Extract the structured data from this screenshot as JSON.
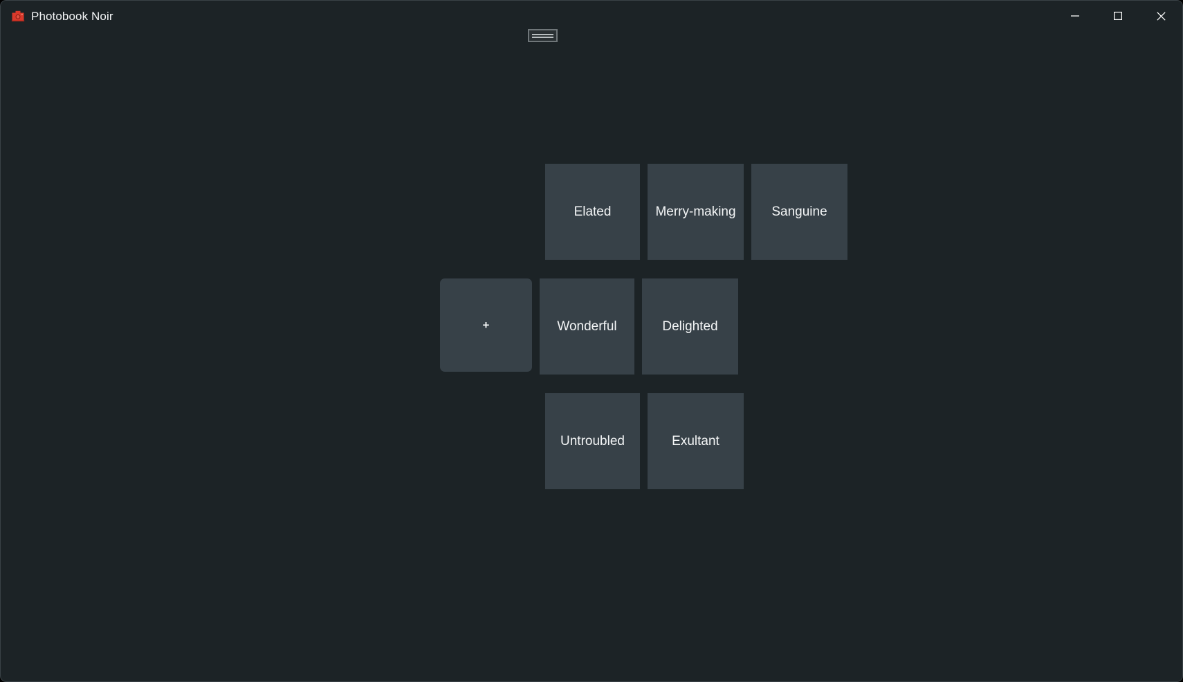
{
  "window": {
    "title": "Photobook Noir",
    "icon": "camera-icon",
    "icon_color": "#d8392b",
    "background_color": "#1c2326",
    "controls": {
      "minimize": "—",
      "maximize": "☐",
      "close": "✕"
    }
  },
  "toolbar": {
    "widget_name": "menu-widget",
    "widget_border_color": "#6f7679",
    "widget_line_color": "#b9bfc1"
  },
  "grid": {
    "tile_color": "#374148",
    "tile_text_color": "#f4f6f7",
    "rows": [
      {
        "tiles": [
          {
            "label": "Elated",
            "kind": "mood"
          },
          {
            "label": "Merry-making",
            "kind": "mood"
          },
          {
            "label": "Sanguine",
            "kind": "mood"
          }
        ]
      },
      {
        "tiles": [
          {
            "label": "+",
            "kind": "add"
          },
          {
            "label": "Wonderful",
            "kind": "mood"
          },
          {
            "label": "Delighted",
            "kind": "mood"
          }
        ]
      },
      {
        "tiles": [
          {
            "label": "Untroubled",
            "kind": "mood"
          },
          {
            "label": "Exultant",
            "kind": "mood"
          }
        ]
      }
    ]
  }
}
